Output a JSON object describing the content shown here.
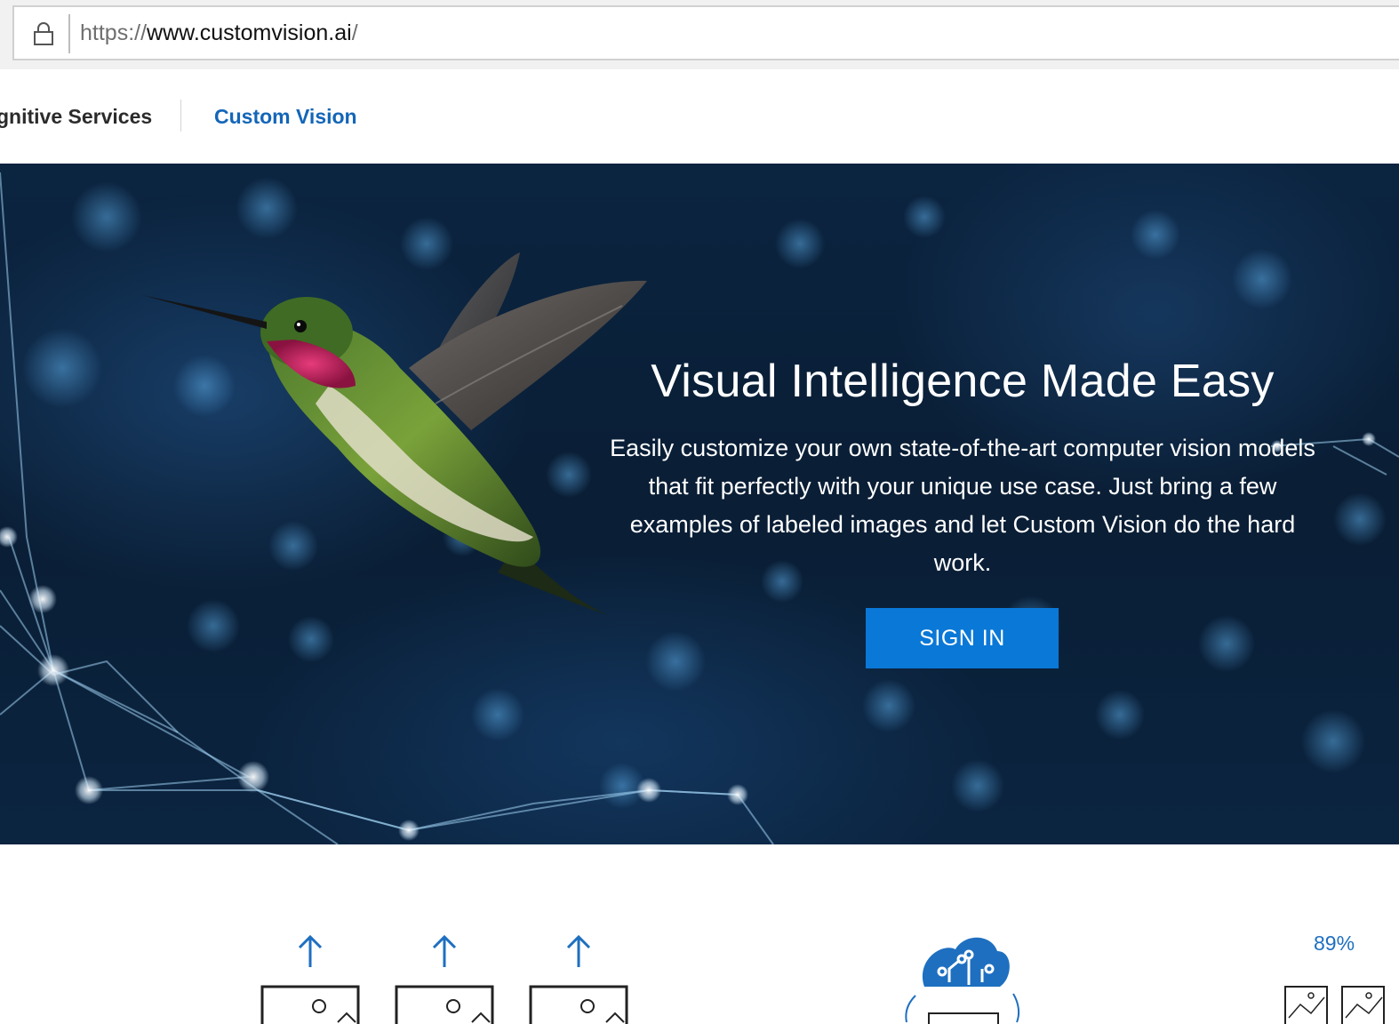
{
  "browser": {
    "url_protocol": "https://",
    "url_domain": "www.customvision.ai",
    "url_path": "/"
  },
  "nav": {
    "cognitive_services_label": "gnitive Services",
    "custom_vision_label": "Custom Vision"
  },
  "hero": {
    "title": "Visual Intelligence Made Easy",
    "description": "Easily customize your own state-of-the-art computer vision models that fit perfectly with your unique use case. Just bring a few examples of labeled images and let Custom Vision do the hard work.",
    "signin_label": "SIGN IN"
  },
  "steps": {
    "accuracy_label": "89%"
  },
  "colors": {
    "brand_blue": "#0a78d7",
    "nav_blue": "#1366b8"
  }
}
